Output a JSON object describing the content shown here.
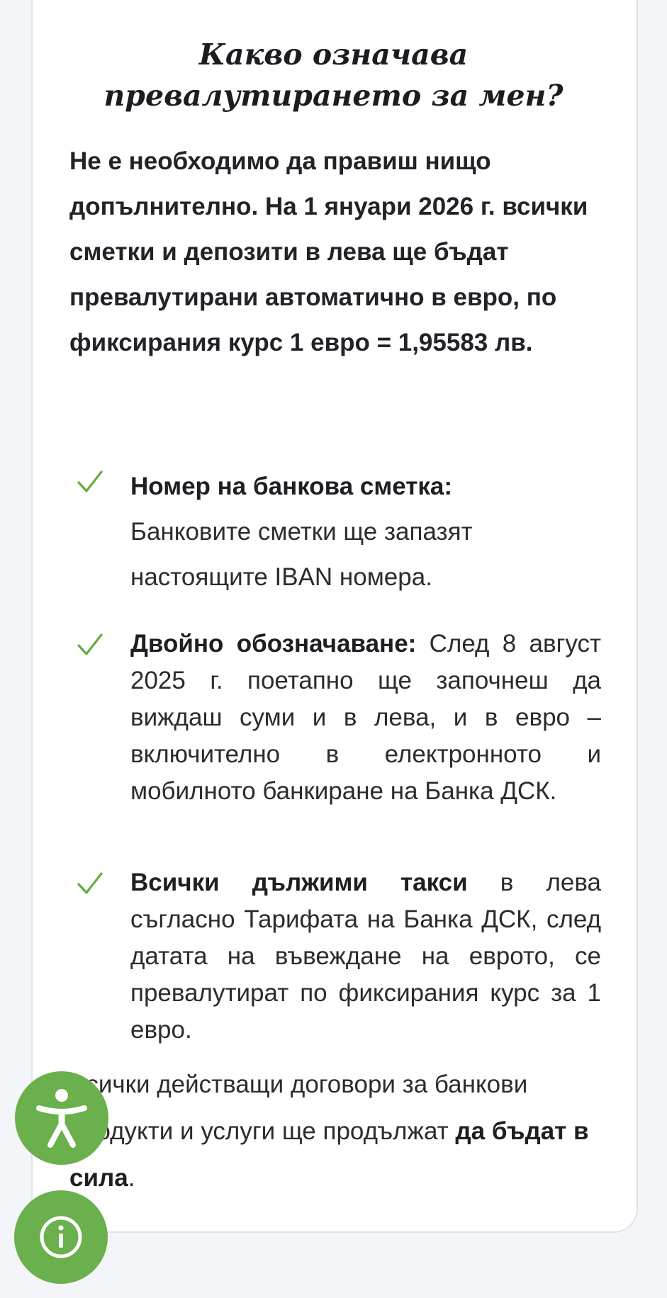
{
  "title": {
    "line1": "Какво означава",
    "line2": "превалутирането за мен?"
  },
  "intro": "Не е необходимо да правиш нищо допълнително. На 1 януари 2026 г. всички сметки и депозити в лева ще бъдат превалутирани автоматично в евро, по фиксирания курс 1 евро = 1,95583 лв.",
  "items": [
    {
      "heading": "Номер на банкова сметка:",
      "text": "Банковите сметки ще запазят настоящите IBAN номера."
    },
    {
      "heading": "Двойно обозначаване:",
      "text": "След 8 август 2025 г. поетапно ще започнеш да виждаш суми и в лева, и в евро – включително в електронното и мобилното банкиране на Банка ДСК."
    },
    {
      "heading": "Всички дължими такси",
      "text": "в лева съгласно Тарифата на Банка ДСК, след датата на въвеждане на еврото, се превалутират по фиксирания курс за 1 евро."
    }
  ],
  "outro": {
    "text": "Всички действащи договори за банкови продукти и услуги ще продължат ",
    "emphasis": "да бъдат в сила",
    "end": "."
  },
  "icons": {
    "check": "check-icon",
    "accessibility": "accessibility-icon",
    "info": "info-icon"
  },
  "colors": {
    "accent_green": "#6ab04c",
    "check_green": "#5fae3e",
    "card_border": "#dfe3ec",
    "page_background": "#f4f5f9"
  }
}
